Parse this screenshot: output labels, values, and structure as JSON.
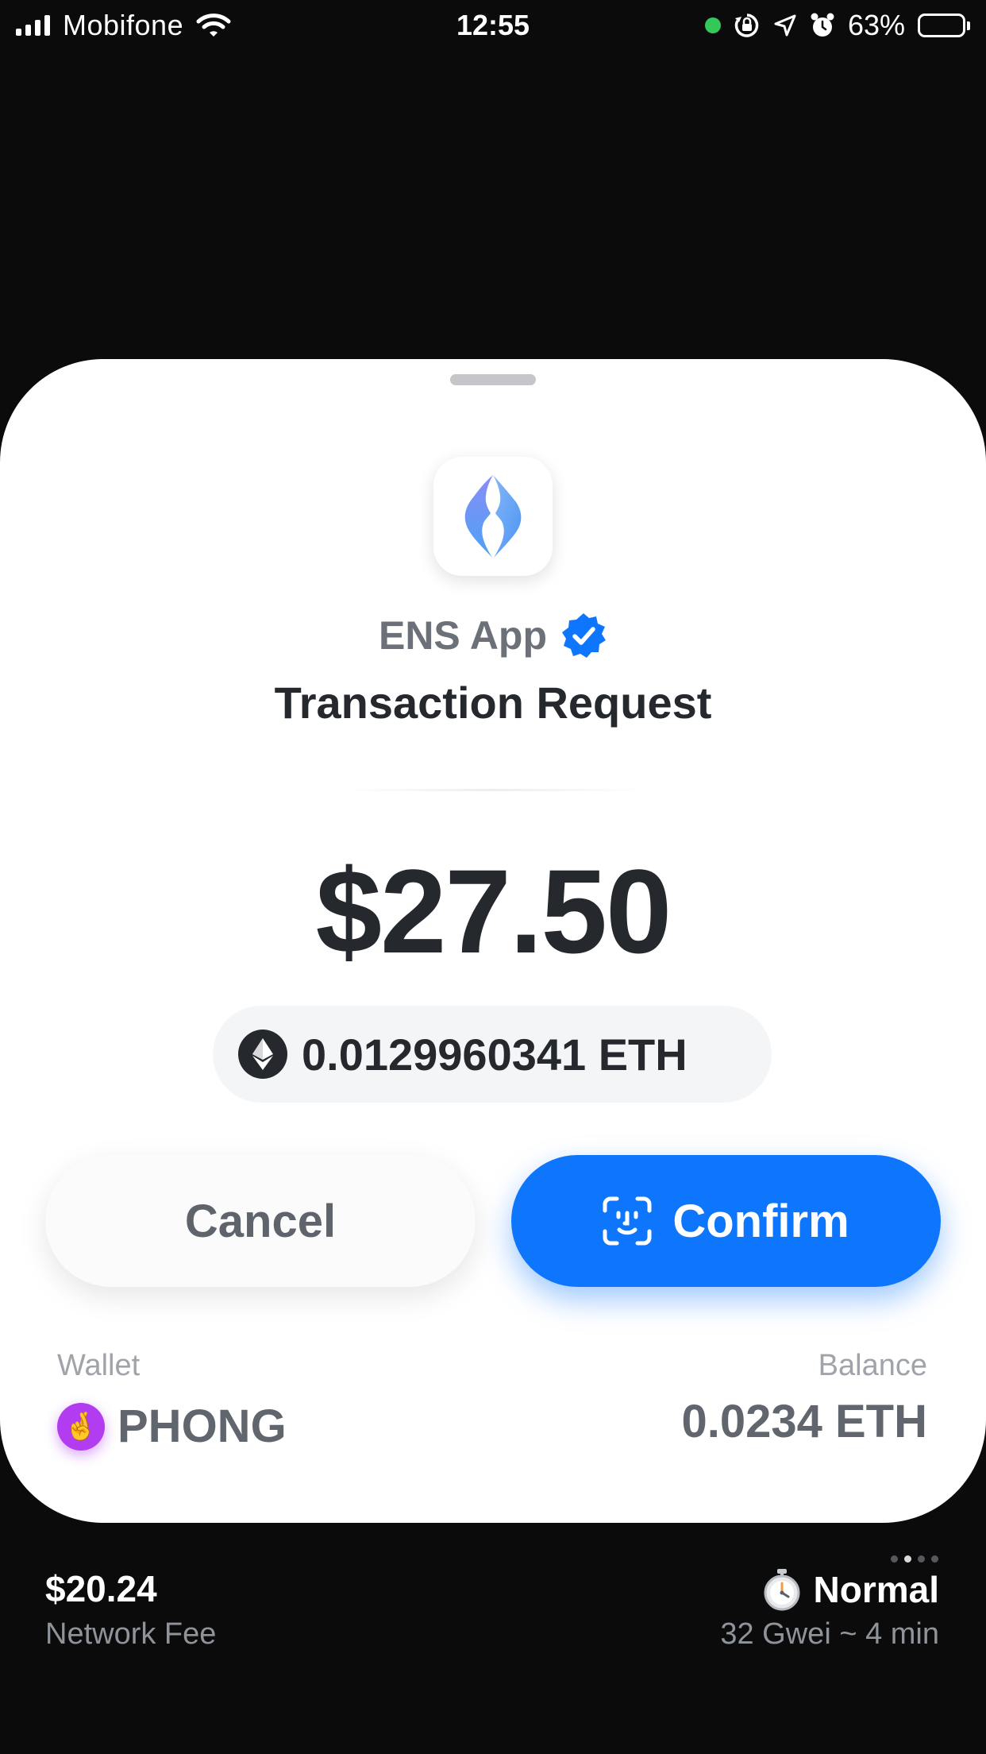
{
  "status_bar": {
    "carrier": "Mobifone",
    "time": "12:55",
    "battery": "63%",
    "battery_level": 0.63,
    "icons": [
      "signal-icon",
      "wifi-icon",
      "camera-indicator-dot",
      "orientation-lock-icon",
      "location-icon",
      "alarm-icon",
      "battery-icon"
    ]
  },
  "sheet": {
    "app_name": "ENS App",
    "app_icon": "ens-logo-icon",
    "verified_icon": "verified-badge-icon",
    "title": "Transaction Request",
    "amount_usd": "$27.50",
    "amount_eth": "0.0129960341 ETH",
    "eth_icon": "ethereum-icon",
    "cancel_label": "Cancel",
    "confirm_label": "Confirm",
    "confirm_icon": "face-id-icon",
    "wallet_label": "Wallet",
    "wallet_name": "PHONG",
    "wallet_avatar": "🤞",
    "balance_label": "Balance",
    "balance_value": "0.0234 ETH"
  },
  "gas": {
    "fee_amount": "$20.24",
    "fee_label": "Network Fee",
    "speed_icon": "stopwatch-icon",
    "speed": "Normal",
    "detail": "32 Gwei ~ 4 min",
    "page_dots_count": 4,
    "page_dots_active": 1
  },
  "colors": {
    "accent": "#0e76fd",
    "background": "#0b0b0c",
    "sheet": "#ffffff",
    "avatar": "#b13cf0",
    "status_green": "#34c759"
  }
}
